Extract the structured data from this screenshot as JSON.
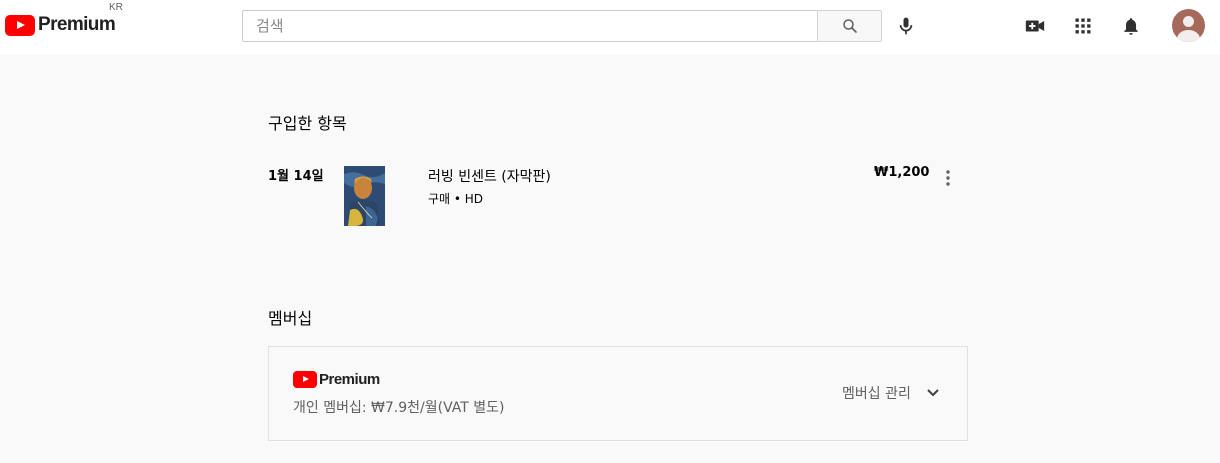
{
  "header": {
    "logo_text": "Premium",
    "country_code": "KR",
    "search_placeholder": "검색",
    "icons": [
      "search-icon",
      "mic-icon",
      "create-video-icon",
      "apps-grid-icon",
      "bell-icon",
      "avatar"
    ]
  },
  "purchases": {
    "title": "구입한 항목",
    "items": [
      {
        "date": "1월 14일",
        "title": "러빙 빈센트 (자막판)",
        "meta": "구매 • HD",
        "price": "₩1,200"
      }
    ]
  },
  "membership": {
    "title": "멤버십",
    "logo_text": "Premium",
    "plan": "개인 멤버십: ₩7.9천/월(VAT 별도)",
    "manage_label": "멤버십 관리"
  },
  "colors": {
    "brand_red": "#ff0000",
    "background": "#f9f9f9",
    "text_primary": "#030303",
    "text_secondary": "#606060"
  }
}
